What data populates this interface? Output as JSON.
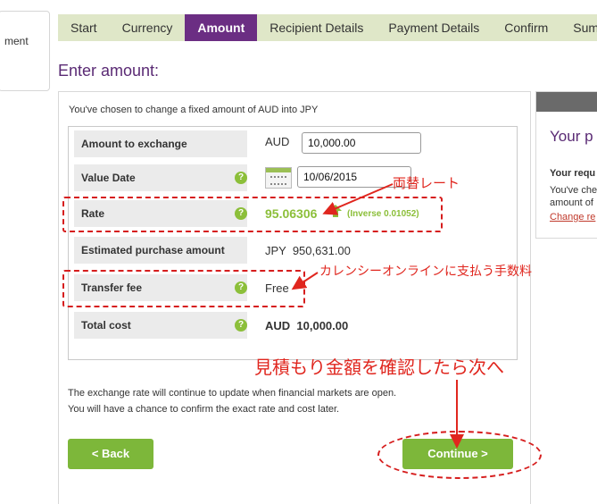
{
  "left_panel": {
    "label": "ment"
  },
  "steps": [
    {
      "label": "Start"
    },
    {
      "label": "Currency"
    },
    {
      "label": "Amount"
    },
    {
      "label": "Recipient Details"
    },
    {
      "label": "Payment Details"
    },
    {
      "label": "Confirm"
    },
    {
      "label": "Sum"
    }
  ],
  "page_title": "Enter amount:",
  "intro": "You've chosen to change a fixed amount of AUD into JPY",
  "form": {
    "amount_label": "Amount to exchange",
    "amount_currency": "AUD",
    "amount_value": "10,000.00",
    "value_date_label": "Value Date",
    "value_date": "10/06/2015",
    "rate_label": "Rate",
    "rate_value": "95.06306",
    "rate_inverse": "(Inverse 0.01052)",
    "estimated_label": "Estimated purchase amount",
    "estimated_value": "JPY  950,631.00",
    "fee_label": "Transfer fee",
    "fee_value": "Free",
    "total_label": "Total cost",
    "total_value": "AUD  10,000.00",
    "help_glyph": "?"
  },
  "notes": {
    "line1": "The exchange rate will continue to update when financial markets are open.",
    "line2": "You will have a chance to confirm the exact rate and cost later."
  },
  "buttons": {
    "back": "< Back",
    "continue": "Continue >"
  },
  "right_panel": {
    "title": "Your p",
    "subtitle": "Your requ",
    "line1": "You've che",
    "line2": "amount of",
    "link": "Change re"
  },
  "annotations": {
    "rate_note": "両替レート",
    "fee_note": "カレンシーオンラインに支払う手数料",
    "continue_note": "見積もり金額を確認したら次へ"
  },
  "colors": {
    "accent_purple": "#6b2e83",
    "nav_bg": "#dfe7c8",
    "button_green": "#7db73a",
    "annotation_red": "#e0261e",
    "rate_green": "#8cbf3a"
  },
  "icons": {
    "calendar": "calendar-icon",
    "rate_up": "arrow-up-icon",
    "help": "help-icon"
  }
}
